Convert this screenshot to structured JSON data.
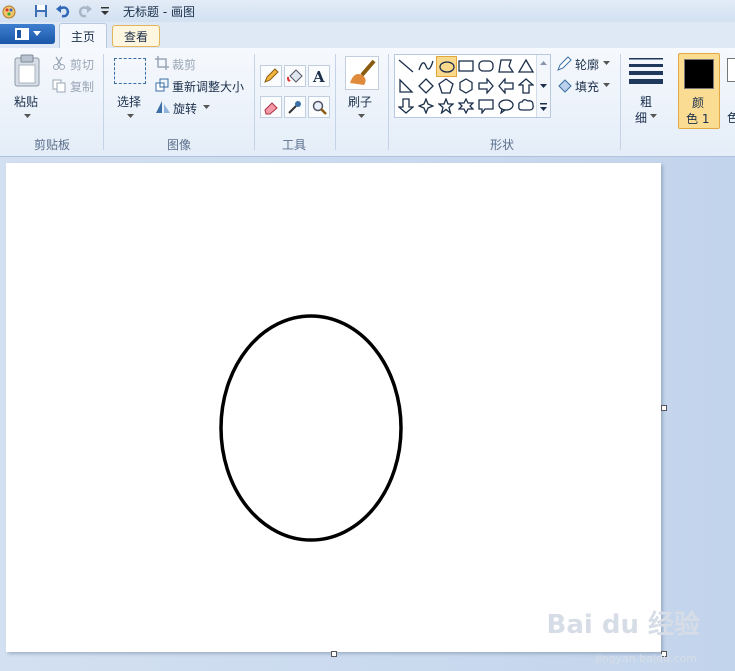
{
  "titlebar": {
    "title": "无标题 - 画图"
  },
  "tabs": {
    "home": "主页",
    "view": "查看"
  },
  "clipboard": {
    "paste": "粘贴",
    "cut": "剪切",
    "copy": "复制",
    "label": "剪贴板"
  },
  "image": {
    "select": "选择",
    "crop": "裁剪",
    "resize": "重新调整大小",
    "rotate": "旋转",
    "label": "图像"
  },
  "tools": {
    "label": "工具"
  },
  "brushes": {
    "label": "刷子"
  },
  "shapes": {
    "outline": "轮廓",
    "fill": "填充",
    "label": "形状"
  },
  "size": {
    "line1": "粗",
    "line2": "细"
  },
  "color1": {
    "line1": "颜",
    "line2": "色 1"
  },
  "colors": {
    "accent": "#2b579a",
    "selected": "#f7c56b",
    "color1": "#000000"
  },
  "watermark": {
    "brand": "Bai du 经验",
    "sub": "jingyan.baidu.com"
  }
}
